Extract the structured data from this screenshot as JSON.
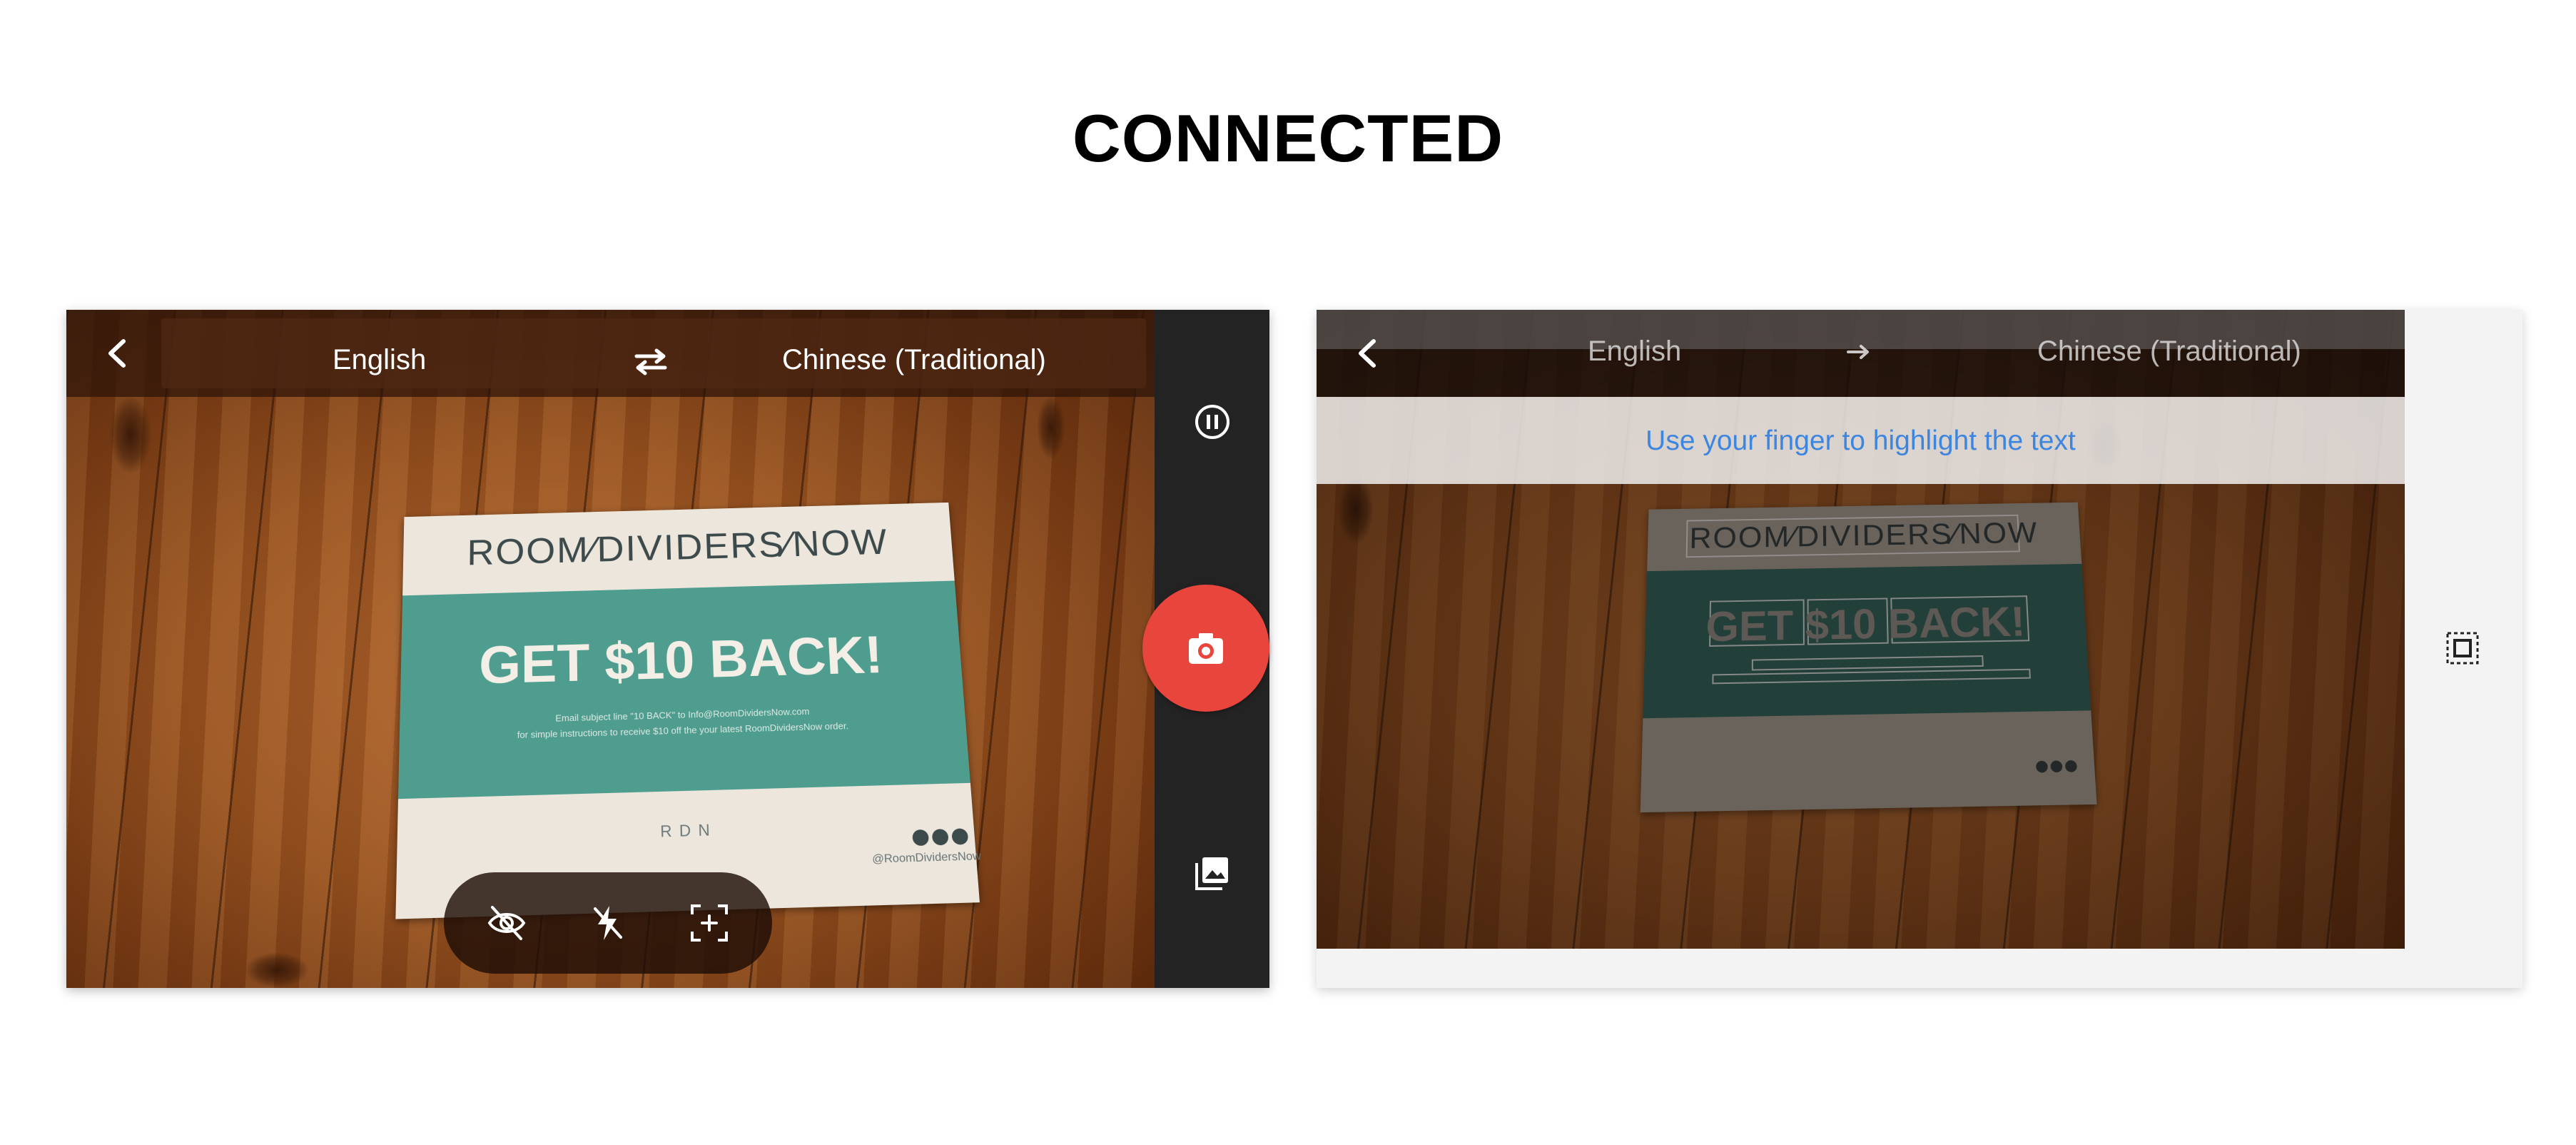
{
  "title": "CONNECTED",
  "left_screen": {
    "source_language": "English",
    "target_language": "Chinese (Traditional)",
    "icons": {
      "back": "back-chevron-icon",
      "swap": "swap-arrows-icon",
      "pause": "pause-icon",
      "capture": "camera-icon",
      "gallery": "gallery-icon",
      "hide": "eye-off-icon",
      "flash": "flash-off-icon",
      "scan": "scan-add-icon"
    },
    "accent_color": "#e8453c",
    "flyer": {
      "brand": "ROOM⁄DIVIDERS⁄NOW",
      "headline": "GET $10 BACK!",
      "fine_print_1": "Email subject line \"10 BACK\" to Info@RoomDividersNow.com",
      "fine_print_2": "for simple instructions to receive $10 off the your latest RoomDividersNow order.",
      "monogram": "R D N",
      "handle": "@RoomDividersNow"
    }
  },
  "right_screen": {
    "source_language": "English",
    "target_language": "Chinese (Traditional)",
    "hint": "Use your finger to highlight the text",
    "hint_color": "#3d86e0",
    "icons": {
      "back": "back-chevron-icon",
      "direction": "arrow-right-icon",
      "select": "select-region-icon"
    },
    "flyer": {
      "brand": "ROOM⁄DIVIDERS⁄NOW",
      "headline": "GET $10 BACK!"
    }
  }
}
